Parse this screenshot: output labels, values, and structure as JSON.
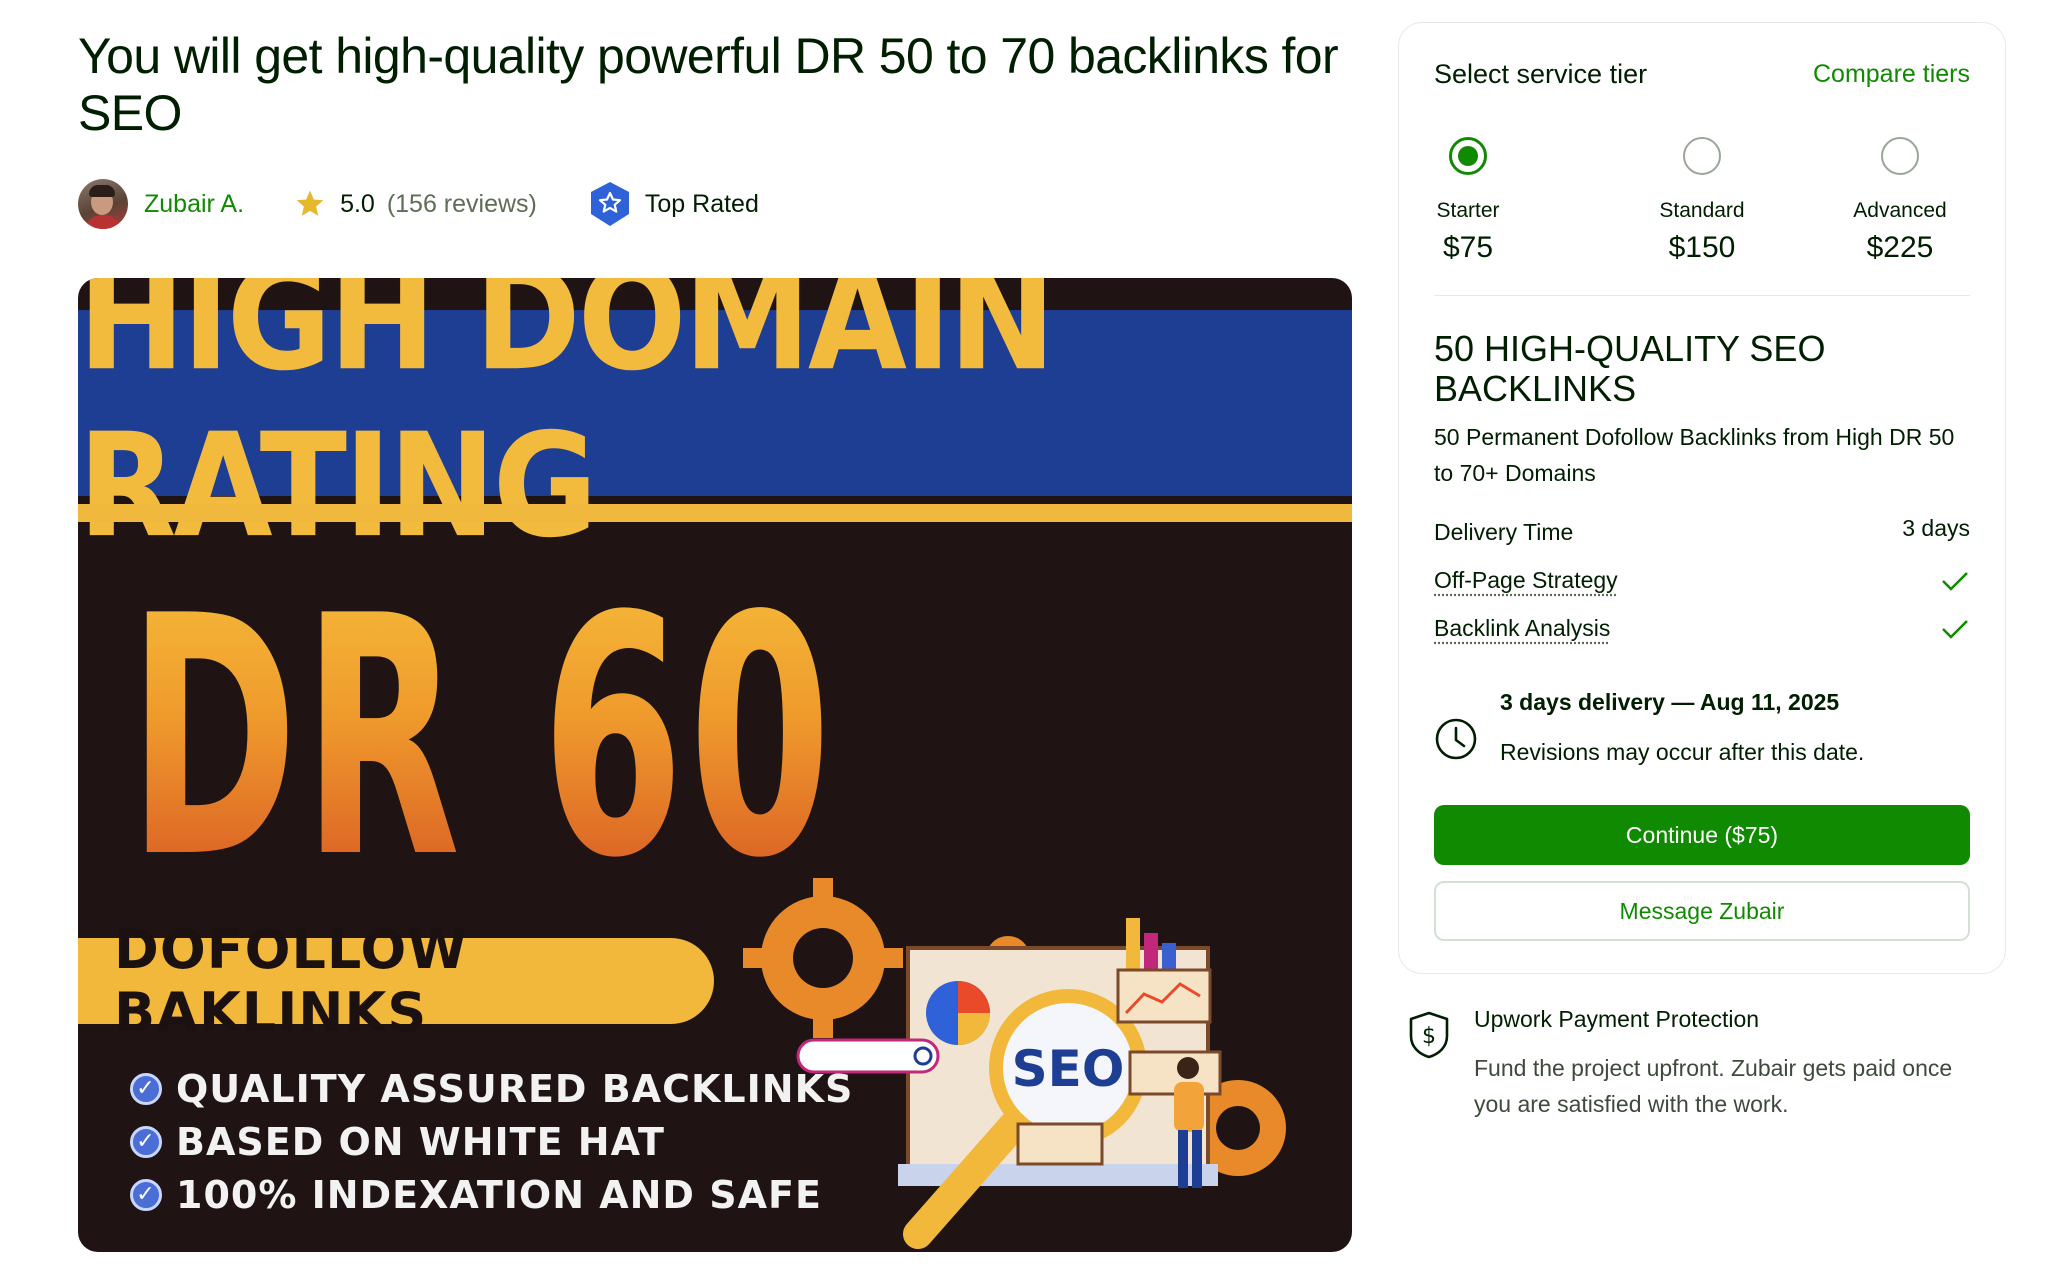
{
  "page": {
    "title": "You will get high-quality powerful DR 50 to 70 backlinks for SEO"
  },
  "seller": {
    "name": "Zubair A.",
    "rating": "5.0",
    "reviews": "(156 reviews)",
    "badge": "Top Rated"
  },
  "hero": {
    "headline": "HIGH DOMAIN RATING",
    "big_text": "DR 60 +",
    "pill": "DOFOLLOW BAKLINKS",
    "bullets": [
      "QUALITY ASSURED BACKLINKS",
      "BASED ON WHITE HAT",
      "100% INDEXATION AND SAFE"
    ],
    "badge_text": "SEO"
  },
  "tiers": {
    "label": "Select service tier",
    "compare": "Compare tiers",
    "options": [
      {
        "name": "Starter",
        "price": "$75",
        "selected": true
      },
      {
        "name": "Standard",
        "price": "$150",
        "selected": false
      },
      {
        "name": "Advanced",
        "price": "$225",
        "selected": false
      }
    ]
  },
  "package": {
    "title": "50 HIGH-QUALITY SEO BACKLINKS",
    "description": "50 Permanent Dofollow Backlinks from High DR 50 to 70+ Domains",
    "delivery_label": "Delivery Time",
    "delivery_value": "3 days",
    "features": [
      "Off-Page Strategy",
      "Backlink Analysis"
    ]
  },
  "delivery": {
    "line1": "3 days delivery — Aug 11, 2025",
    "line2": "Revisions may occur after this date."
  },
  "actions": {
    "continue": "Continue ($75)",
    "message": "Message Zubair"
  },
  "protection": {
    "title": "Upwork Payment Protection",
    "text": "Fund the project upfront. Zubair gets paid once you are satisfied with the work."
  },
  "colors": {
    "brand_green": "#108a00",
    "star": "#e6b82e",
    "badge_blue": "#2f62d8"
  }
}
